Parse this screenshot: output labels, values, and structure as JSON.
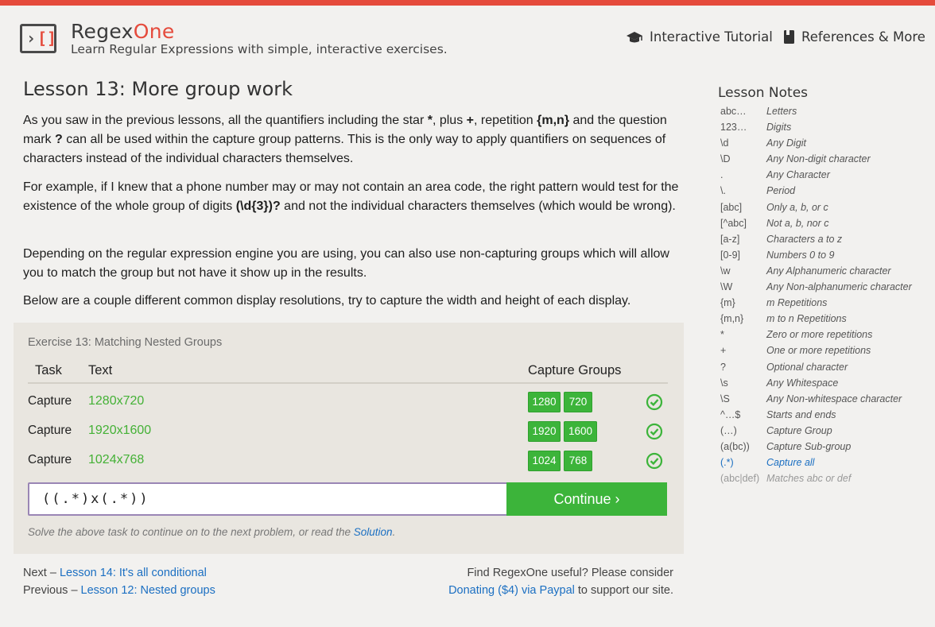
{
  "header": {
    "brand_part1": "Regex",
    "brand_part2": "One",
    "tagline": "Learn Regular Expressions with simple, interactive exercises.",
    "nav_tutorial": "Interactive Tutorial",
    "nav_references": "References & More"
  },
  "lesson": {
    "title": "Lesson 13: More group work",
    "p1": {
      "a": "As you saw in the previous lessons, all the quantifiers including the star ",
      "b": "*",
      "c": ", plus ",
      "d": "+",
      "e": ", repetition ",
      "f": "{m,n}",
      "g": " and the question mark ",
      "h": "?",
      "i": " can all be used within the capture group patterns. This is the only way to apply quantifiers on sequences of characters instead of the individual characters themselves."
    },
    "p2": {
      "a": "For example, if I knew that a phone number may or may not contain an area code, the right pattern would test for the existence of the whole group of digits ",
      "b": "(\\d{3})?",
      "c": " and not the individual characters themselves (which would be wrong)."
    },
    "p3": "Depending on the regular expression engine you are using, you can also use non-capturing groups which will allow you to match the group but not have it show up in the results.",
    "p4": "Below are a couple different common display resolutions, try to capture the width and height of each display."
  },
  "exercise": {
    "title": "Exercise 13: Matching Nested Groups",
    "col_task": "Task",
    "col_text": "Text",
    "col_groups": "Capture Groups",
    "rows": [
      {
        "task": "Capture",
        "text": "1280x720",
        "groups": [
          "1280",
          "720"
        ]
      },
      {
        "task": "Capture",
        "text": "1920x1600",
        "groups": [
          "1920",
          "1600"
        ]
      },
      {
        "task": "Capture",
        "text": "1024x768",
        "groups": [
          "1024",
          "768"
        ]
      }
    ],
    "input_value": "((.*)x(.*))",
    "continue_label": "Continue ›",
    "solve_note": "Solve the above task to continue on to the next problem, or read the ",
    "solution_link": "Solution",
    "solve_note_end": "."
  },
  "footer": {
    "next_prefix": "Next – ",
    "next_link": "Lesson 14: It's all conditional",
    "prev_prefix": "Previous – ",
    "prev_link": "Lesson 12: Nested groups",
    "useful": "Find RegexOne useful? Please consider",
    "donate_link": "Donating ($4) via Paypal",
    "support": " to support our site."
  },
  "notes": {
    "title": "Lesson Notes",
    "items": [
      {
        "k": "abc…",
        "v": "Letters"
      },
      {
        "k": "123…",
        "v": "Digits"
      },
      {
        "k": "\\d",
        "v": "Any Digit"
      },
      {
        "k": "\\D",
        "v": "Any Non-digit character"
      },
      {
        "k": ".",
        "v": "Any Character"
      },
      {
        "k": "\\.",
        "v": "Period"
      },
      {
        "k": "[abc]",
        "v": "Only a, b, or c"
      },
      {
        "k": "[^abc]",
        "v": "Not a, b, nor c"
      },
      {
        "k": "[a-z]",
        "v": "Characters a to z"
      },
      {
        "k": "[0-9]",
        "v": "Numbers 0 to 9"
      },
      {
        "k": "\\w",
        "v": "Any Alphanumeric character"
      },
      {
        "k": "\\W",
        "v": "Any Non-alphanumeric character"
      },
      {
        "k": "{m}",
        "v": "m Repetitions"
      },
      {
        "k": "{m,n}",
        "v": "m to n Repetitions"
      },
      {
        "k": "*",
        "v": "Zero or more repetitions"
      },
      {
        "k": "+",
        "v": "One or more repetitions"
      },
      {
        "k": "?",
        "v": "Optional character"
      },
      {
        "k": "\\s",
        "v": "Any Whitespace"
      },
      {
        "k": "\\S",
        "v": "Any Non-whitespace character"
      },
      {
        "k": "^…$",
        "v": "Starts and ends"
      },
      {
        "k": "(…)",
        "v": "Capture Group"
      },
      {
        "k": "(a(bc))",
        "v": "Capture Sub-group"
      },
      {
        "k": "(.*)",
        "v": "Capture all"
      },
      {
        "k": "(abc|def)",
        "v": "Matches abc or def"
      }
    ]
  },
  "colors": {
    "accent_red": "#e54b3c",
    "success_green": "#3cb43a",
    "link_blue": "#1b6fc2"
  },
  "icons": {
    "logo": "regex-logo-icon",
    "tutorial": "graduation-cap-icon",
    "references": "book-icon",
    "check": "check-circle-icon"
  }
}
